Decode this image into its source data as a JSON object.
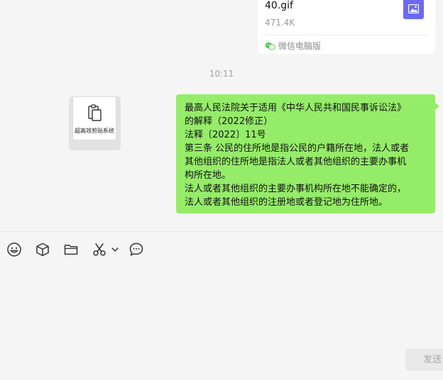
{
  "file_message": {
    "file_name": "40.gif",
    "file_size": "471.4K",
    "source_label": "微信电脑版",
    "thumb_icon": "image-icon",
    "source_icon": "wechat-icon"
  },
  "timestamp": "10:11",
  "sender_avatar": {
    "label": "超高效剪贴系统",
    "icon": "clipboard-icon"
  },
  "message": {
    "lines": [
      "最高人民法院关于适用《中华人民共和国民事诉讼法》",
      "的解释（2022修正）",
      "法释〔2022〕11号",
      "第三条 公民的住所地是指公民的户籍所在地，法人或者",
      "其他组织的住所地是指法人或者其他组织的主要办事机",
      "构所在地。",
      "法人或者其他组织的主要办事机构所在地不能确定的，",
      "法人或者其他组织的注册地或者登记地为住所地。"
    ]
  },
  "toolbar": {
    "icons": [
      "emoji-icon",
      "box-icon",
      "folder-icon",
      "scissors-icon",
      "chevron-down-icon",
      "chat-bubble-icon"
    ]
  },
  "send_label": "发送",
  "colors": {
    "bubble": "#95ec69",
    "thumb": "#6b6bf3",
    "background": "#f5f5f5"
  }
}
